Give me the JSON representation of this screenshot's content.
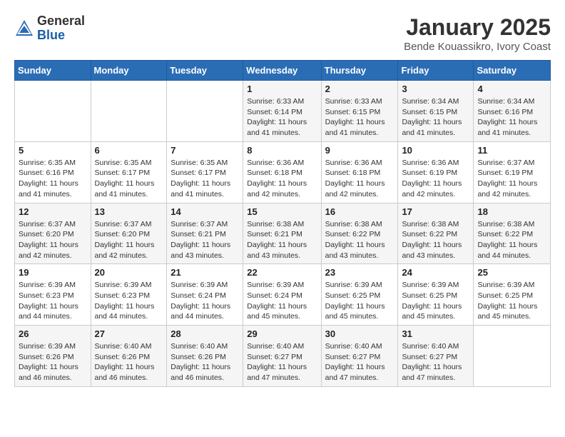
{
  "logo": {
    "general": "General",
    "blue": "Blue"
  },
  "header": {
    "month_year": "January 2025",
    "location": "Bende Kouassikro, Ivory Coast"
  },
  "weekdays": [
    "Sunday",
    "Monday",
    "Tuesday",
    "Wednesday",
    "Thursday",
    "Friday",
    "Saturday"
  ],
  "weeks": [
    [
      {
        "day": "",
        "sunrise": "",
        "sunset": "",
        "daylight": ""
      },
      {
        "day": "",
        "sunrise": "",
        "sunset": "",
        "daylight": ""
      },
      {
        "day": "",
        "sunrise": "",
        "sunset": "",
        "daylight": ""
      },
      {
        "day": "1",
        "sunrise": "Sunrise: 6:33 AM",
        "sunset": "Sunset: 6:14 PM",
        "daylight": "Daylight: 11 hours and 41 minutes."
      },
      {
        "day": "2",
        "sunrise": "Sunrise: 6:33 AM",
        "sunset": "Sunset: 6:15 PM",
        "daylight": "Daylight: 11 hours and 41 minutes."
      },
      {
        "day": "3",
        "sunrise": "Sunrise: 6:34 AM",
        "sunset": "Sunset: 6:15 PM",
        "daylight": "Daylight: 11 hours and 41 minutes."
      },
      {
        "day": "4",
        "sunrise": "Sunrise: 6:34 AM",
        "sunset": "Sunset: 6:16 PM",
        "daylight": "Daylight: 11 hours and 41 minutes."
      }
    ],
    [
      {
        "day": "5",
        "sunrise": "Sunrise: 6:35 AM",
        "sunset": "Sunset: 6:16 PM",
        "daylight": "Daylight: 11 hours and 41 minutes."
      },
      {
        "day": "6",
        "sunrise": "Sunrise: 6:35 AM",
        "sunset": "Sunset: 6:17 PM",
        "daylight": "Daylight: 11 hours and 41 minutes."
      },
      {
        "day": "7",
        "sunrise": "Sunrise: 6:35 AM",
        "sunset": "Sunset: 6:17 PM",
        "daylight": "Daylight: 11 hours and 41 minutes."
      },
      {
        "day": "8",
        "sunrise": "Sunrise: 6:36 AM",
        "sunset": "Sunset: 6:18 PM",
        "daylight": "Daylight: 11 hours and 42 minutes."
      },
      {
        "day": "9",
        "sunrise": "Sunrise: 6:36 AM",
        "sunset": "Sunset: 6:18 PM",
        "daylight": "Daylight: 11 hours and 42 minutes."
      },
      {
        "day": "10",
        "sunrise": "Sunrise: 6:36 AM",
        "sunset": "Sunset: 6:19 PM",
        "daylight": "Daylight: 11 hours and 42 minutes."
      },
      {
        "day": "11",
        "sunrise": "Sunrise: 6:37 AM",
        "sunset": "Sunset: 6:19 PM",
        "daylight": "Daylight: 11 hours and 42 minutes."
      }
    ],
    [
      {
        "day": "12",
        "sunrise": "Sunrise: 6:37 AM",
        "sunset": "Sunset: 6:20 PM",
        "daylight": "Daylight: 11 hours and 42 minutes."
      },
      {
        "day": "13",
        "sunrise": "Sunrise: 6:37 AM",
        "sunset": "Sunset: 6:20 PM",
        "daylight": "Daylight: 11 hours and 42 minutes."
      },
      {
        "day": "14",
        "sunrise": "Sunrise: 6:37 AM",
        "sunset": "Sunset: 6:21 PM",
        "daylight": "Daylight: 11 hours and 43 minutes."
      },
      {
        "day": "15",
        "sunrise": "Sunrise: 6:38 AM",
        "sunset": "Sunset: 6:21 PM",
        "daylight": "Daylight: 11 hours and 43 minutes."
      },
      {
        "day": "16",
        "sunrise": "Sunrise: 6:38 AM",
        "sunset": "Sunset: 6:22 PM",
        "daylight": "Daylight: 11 hours and 43 minutes."
      },
      {
        "day": "17",
        "sunrise": "Sunrise: 6:38 AM",
        "sunset": "Sunset: 6:22 PM",
        "daylight": "Daylight: 11 hours and 43 minutes."
      },
      {
        "day": "18",
        "sunrise": "Sunrise: 6:38 AM",
        "sunset": "Sunset: 6:22 PM",
        "daylight": "Daylight: 11 hours and 44 minutes."
      }
    ],
    [
      {
        "day": "19",
        "sunrise": "Sunrise: 6:39 AM",
        "sunset": "Sunset: 6:23 PM",
        "daylight": "Daylight: 11 hours and 44 minutes."
      },
      {
        "day": "20",
        "sunrise": "Sunrise: 6:39 AM",
        "sunset": "Sunset: 6:23 PM",
        "daylight": "Daylight: 11 hours and 44 minutes."
      },
      {
        "day": "21",
        "sunrise": "Sunrise: 6:39 AM",
        "sunset": "Sunset: 6:24 PM",
        "daylight": "Daylight: 11 hours and 44 minutes."
      },
      {
        "day": "22",
        "sunrise": "Sunrise: 6:39 AM",
        "sunset": "Sunset: 6:24 PM",
        "daylight": "Daylight: 11 hours and 45 minutes."
      },
      {
        "day": "23",
        "sunrise": "Sunrise: 6:39 AM",
        "sunset": "Sunset: 6:25 PM",
        "daylight": "Daylight: 11 hours and 45 minutes."
      },
      {
        "day": "24",
        "sunrise": "Sunrise: 6:39 AM",
        "sunset": "Sunset: 6:25 PM",
        "daylight": "Daylight: 11 hours and 45 minutes."
      },
      {
        "day": "25",
        "sunrise": "Sunrise: 6:39 AM",
        "sunset": "Sunset: 6:25 PM",
        "daylight": "Daylight: 11 hours and 45 minutes."
      }
    ],
    [
      {
        "day": "26",
        "sunrise": "Sunrise: 6:39 AM",
        "sunset": "Sunset: 6:26 PM",
        "daylight": "Daylight: 11 hours and 46 minutes."
      },
      {
        "day": "27",
        "sunrise": "Sunrise: 6:40 AM",
        "sunset": "Sunset: 6:26 PM",
        "daylight": "Daylight: 11 hours and 46 minutes."
      },
      {
        "day": "28",
        "sunrise": "Sunrise: 6:40 AM",
        "sunset": "Sunset: 6:26 PM",
        "daylight": "Daylight: 11 hours and 46 minutes."
      },
      {
        "day": "29",
        "sunrise": "Sunrise: 6:40 AM",
        "sunset": "Sunset: 6:27 PM",
        "daylight": "Daylight: 11 hours and 47 minutes."
      },
      {
        "day": "30",
        "sunrise": "Sunrise: 6:40 AM",
        "sunset": "Sunset: 6:27 PM",
        "daylight": "Daylight: 11 hours and 47 minutes."
      },
      {
        "day": "31",
        "sunrise": "Sunrise: 6:40 AM",
        "sunset": "Sunset: 6:27 PM",
        "daylight": "Daylight: 11 hours and 47 minutes."
      },
      {
        "day": "",
        "sunrise": "",
        "sunset": "",
        "daylight": ""
      }
    ]
  ]
}
